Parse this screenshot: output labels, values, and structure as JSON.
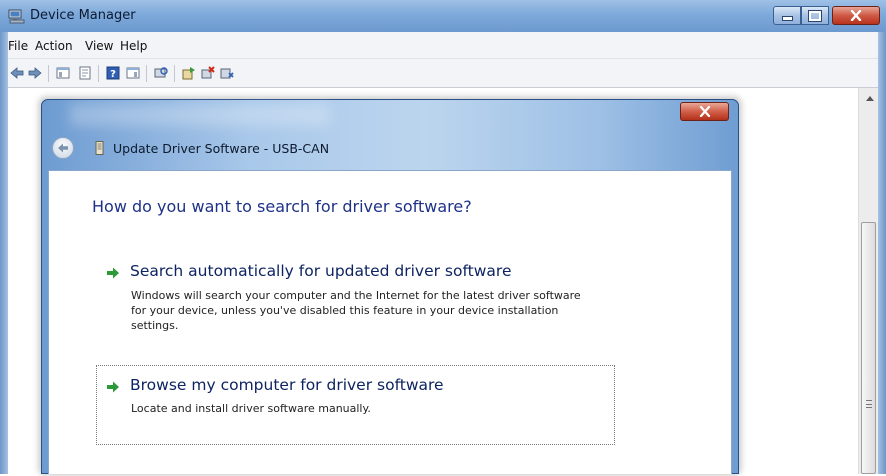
{
  "window": {
    "title": "Device Manager",
    "controls": {
      "minimize": "minimize-icon",
      "maximize": "maximize-icon",
      "close": "close-icon"
    }
  },
  "menubar": {
    "items": [
      "File",
      "Action",
      "View",
      "Help"
    ]
  },
  "toolbar": {
    "icons": [
      "back-icon",
      "forward-icon",
      "show-hide-tree-icon",
      "properties-icon",
      "help-icon",
      "details-view-icon",
      "scan-hardware-icon",
      "update-driver-icon",
      "uninstall-icon",
      "disable-icon"
    ]
  },
  "dialog": {
    "title": "Update Driver Software - USB-CAN",
    "heading": "How do you want to search for driver software?",
    "options": [
      {
        "title": "Search automatically for updated driver software",
        "description": [
          "Windows will search your computer and the Internet for the latest driver software",
          "for your device, unless you've disabled this feature in your device installation",
          "settings."
        ]
      },
      {
        "title": "Browse my computer for driver software",
        "description": [
          "Locate and install driver software manually."
        ]
      }
    ]
  },
  "colors": {
    "accent": "#1e3287",
    "option_arrow": "#2d9a3a",
    "close_red": "#c7422c",
    "titlebar": "#7ea9da"
  }
}
